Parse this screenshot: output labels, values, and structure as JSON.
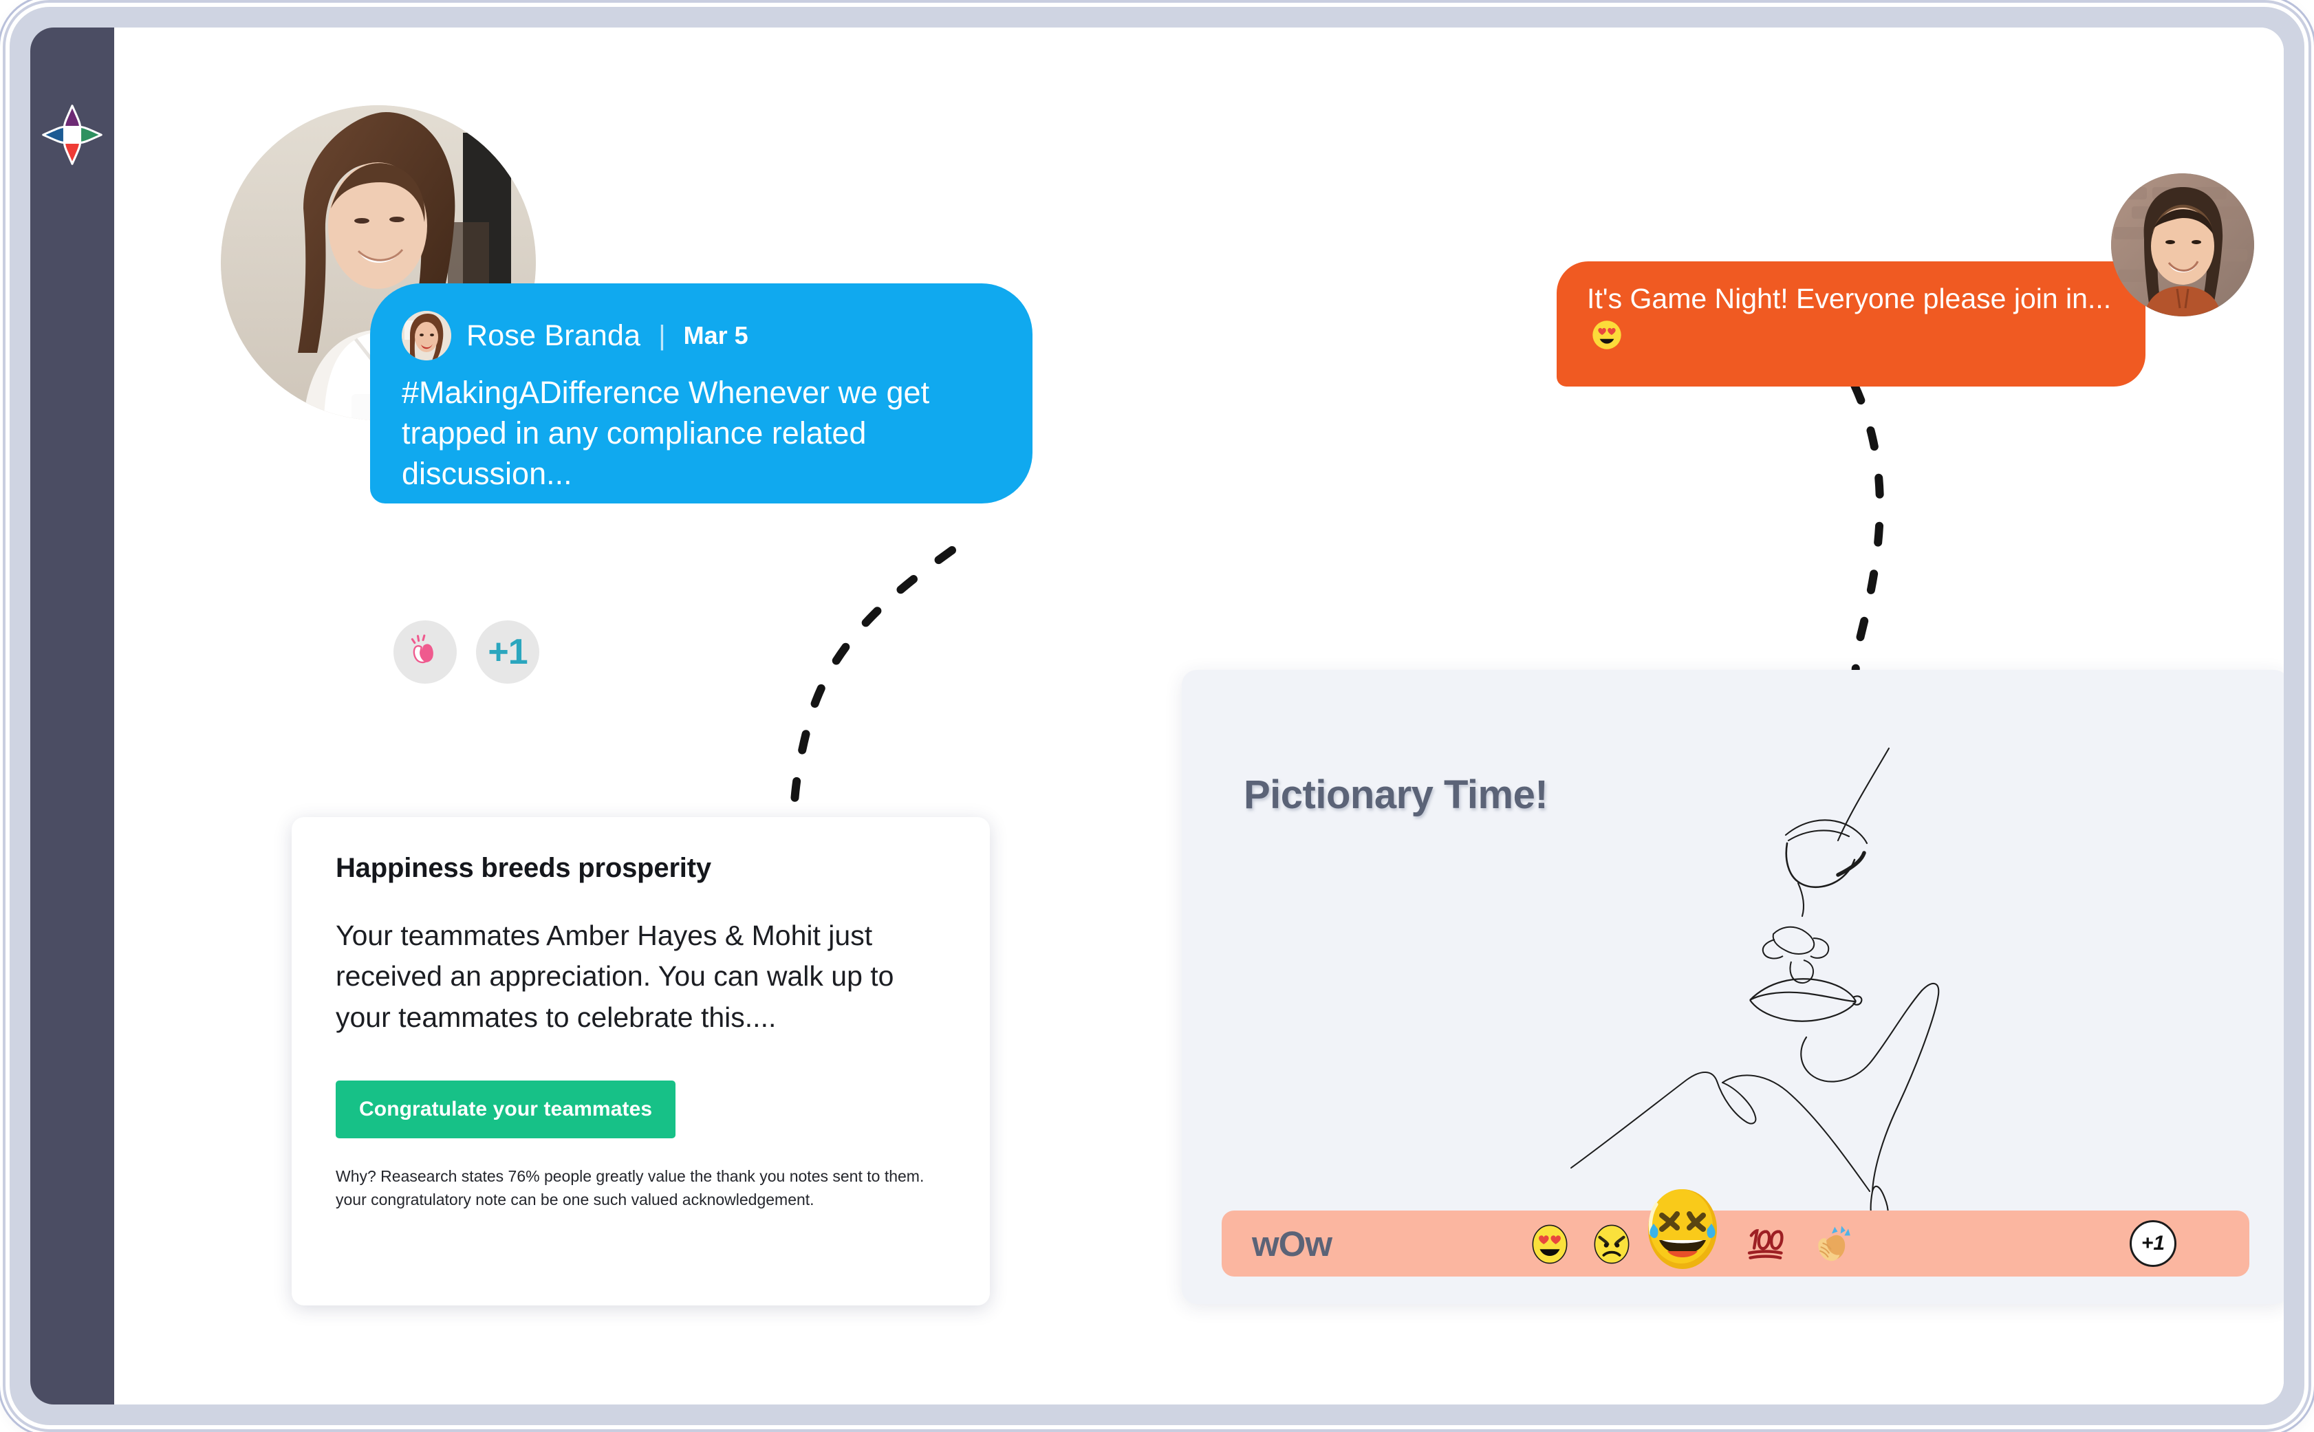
{
  "app": {
    "logo_name": "four-point-compass-logo",
    "logo_colors": {
      "top": "#6d2a74",
      "left": "#1d5b93",
      "right": "#2e9160",
      "bottom": "#ef3b35",
      "center": "#ffffff"
    },
    "sidebar_color": "#4b4d63",
    "canvas_color": "#ffffff",
    "bezel_color": "#cfd4e2"
  },
  "post": {
    "author": "Rose Branda",
    "separator": "|",
    "date": "Mar 5",
    "hashtag": "#MakingADifference",
    "body": " Whenever we get trapped in any compliance related discussion...",
    "bubble_color": "#10a9ef",
    "avatar_name": "rose-branda-avatar",
    "hero_avatar_name": "hero-user-photo"
  },
  "reactions": {
    "chips": [
      {
        "name": "clap-reaction-chip",
        "glyph": "clap",
        "label": ""
      },
      {
        "name": "plus-one-chip",
        "glyph": "text",
        "label": "+1"
      }
    ],
    "chip_bg": "#e7e7e7",
    "plus_one_color": "#2ba6be"
  },
  "game_night": {
    "text": "It's Game Night! Everyone please join in...",
    "emoji": "heart-eyes",
    "bubble_color": "#f05a22",
    "avatar_name": "game-night-sender-avatar"
  },
  "note_card": {
    "title": "Happiness breeds prosperity",
    "body": "Your teammates Amber Hayes & Mohit just received an appreciation. You can walk up to your teammates to celebrate this....",
    "cta_label": "Congratulate your teammates",
    "cta_color": "#17c187",
    "footnote": "Why? Reasearch states 76% people greatly value the thank you notes sent to them. your congratulatory note can be one such valued acknowledgement."
  },
  "pictionary": {
    "title": "Pictionary Time!",
    "title_color": "#5b6377",
    "card_bg": "#f1f3f8",
    "artwork_name": "single-line-face-drawing",
    "bar": {
      "label": "wOw",
      "bar_color": "#fbb6a0",
      "emojis": [
        {
          "name": "heart-eyes-emoji",
          "glyph": "heart-eyes"
        },
        {
          "name": "angry-face-emoji",
          "glyph": "angry"
        },
        {
          "name": "joy-tears-emoji",
          "glyph": "joy"
        },
        {
          "name": "hundred-points-emoji",
          "glyph": "100"
        },
        {
          "name": "clapping-hands-emoji",
          "glyph": "clap"
        }
      ],
      "plus_one_label": "+1"
    }
  },
  "connectors": [
    {
      "name": "blue-bubble-to-note-card-connector",
      "style": "dashed-curve"
    },
    {
      "name": "orange-bubble-to-pictionary-connector",
      "style": "dashed-curve"
    }
  ]
}
